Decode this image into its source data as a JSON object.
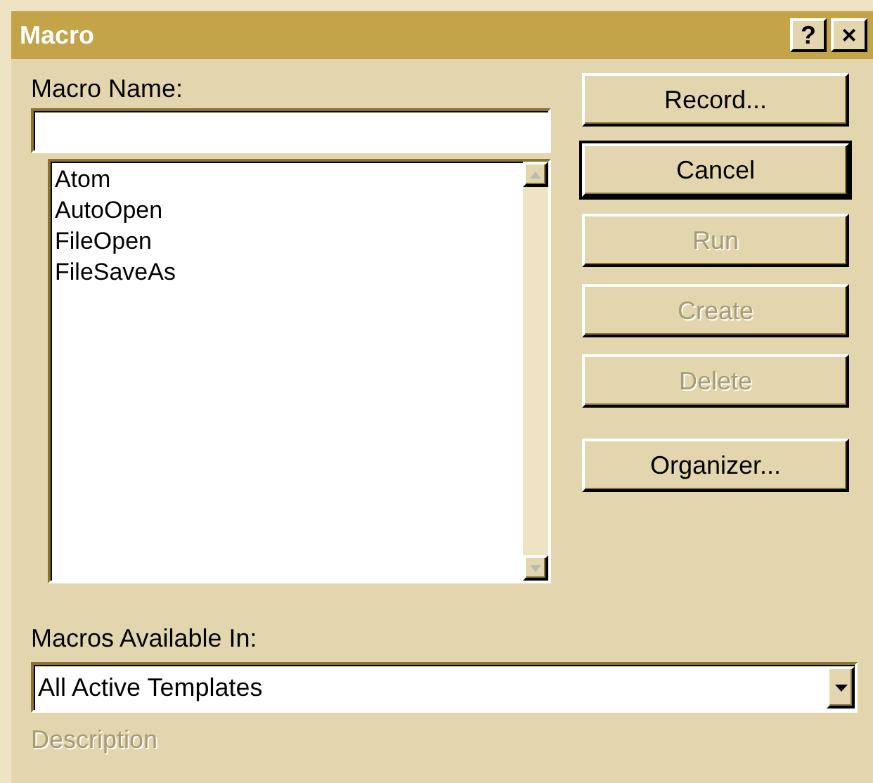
{
  "window": {
    "title": "Macro",
    "buttons": [
      "?",
      "×"
    ]
  },
  "macro_name": {
    "label": "Macro Name:"
  },
  "macros": [
    {
      "name": "Atom",
      "selected": false
    },
    {
      "name": "AutoOpen",
      "selected": false
    },
    {
      "name": "FileOpen",
      "selected": false
    },
    {
      "name": "FileSaveAs",
      "selected": false
    }
  ],
  "buttons": [
    {
      "label": "Record...",
      "disabled": false,
      "default": false
    },
    {
      "label": "Cancel",
      "disabled": false,
      "default": true
    },
    {
      "label": "Run",
      "disabled": true,
      "default": false
    },
    {
      "label": "Create",
      "disabled": true,
      "default": false
    },
    {
      "label": "Delete",
      "disabled": true,
      "default": false
    },
    {
      "label": "Organizer...",
      "disabled": false,
      "default": false
    }
  ],
  "available_in": {
    "label": "Macros Available In:",
    "value": "All Active Templates"
  },
  "description": {
    "label": "Description",
    "disabled": true
  }
}
